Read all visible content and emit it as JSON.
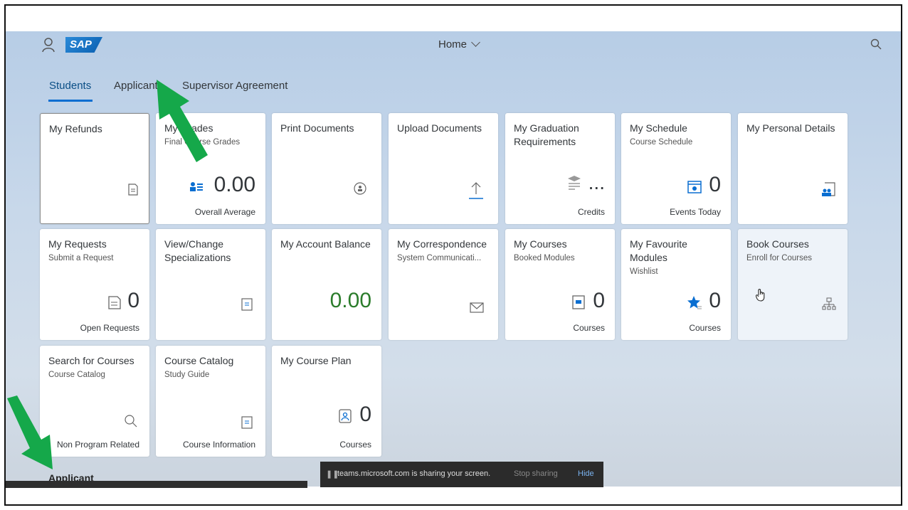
{
  "shell": {
    "logo": "SAP",
    "home_label": "Home"
  },
  "tabs": [
    {
      "label": "Students"
    },
    {
      "label": "Applicant"
    },
    {
      "label": "Supervisor Agreement"
    }
  ],
  "tiles": [
    {
      "title": "My Refunds",
      "subtitle": "",
      "number": "",
      "footer": ""
    },
    {
      "title": "My Grades",
      "subtitle": "Final Course Grades",
      "number": "0.00",
      "footer": "Overall Average"
    },
    {
      "title": "Print Documents",
      "subtitle": "",
      "number": "",
      "footer": ""
    },
    {
      "title": "Upload Documents",
      "subtitle": "",
      "number": "",
      "footer": ""
    },
    {
      "title": "My Graduation Requirements",
      "subtitle": "",
      "number": "...",
      "footer": "Credits"
    },
    {
      "title": "My Schedule",
      "subtitle": "Course Schedule",
      "number": "0",
      "footer": "Events Today"
    },
    {
      "title": "My Personal Details",
      "subtitle": "",
      "number": "",
      "footer": ""
    },
    {
      "title": "My Requests",
      "subtitle": "Submit a Request",
      "number": "0",
      "footer": "Open Requests"
    },
    {
      "title": "View/Change Specializations",
      "subtitle": "",
      "number": "",
      "footer": ""
    },
    {
      "title": "My Account Balance",
      "subtitle": "",
      "number": "0.00",
      "footer": ""
    },
    {
      "title": "My Correspondence",
      "subtitle": "System Communicati...",
      "number": "",
      "footer": ""
    },
    {
      "title": "My Courses",
      "subtitle": "Booked Modules",
      "number": "0",
      "footer": "Courses"
    },
    {
      "title": "My Favourite Modules",
      "subtitle": "Wishlist",
      "number": "0",
      "footer": "Courses"
    },
    {
      "title": "Book Courses",
      "subtitle": "Enroll for Courses",
      "number": "",
      "footer": ""
    },
    {
      "title": "Search for Courses",
      "subtitle": "Course Catalog",
      "number": "",
      "footer": "Non Program Related"
    },
    {
      "title": "Course Catalog",
      "subtitle": "Study Guide",
      "number": "",
      "footer": "Course Information"
    },
    {
      "title": "My Course Plan",
      "subtitle": "",
      "number": "0",
      "footer": "Courses"
    }
  ],
  "section_label": "Applicant",
  "teams_bar": {
    "message": "teams.microsoft.com is sharing your screen.",
    "stop_label": "Stop sharing",
    "hide_label": "Hide"
  },
  "colors": {
    "accent": "#0a6ed1",
    "balance_green": "#2b7c2b",
    "arrow_green": "#15a84a"
  }
}
